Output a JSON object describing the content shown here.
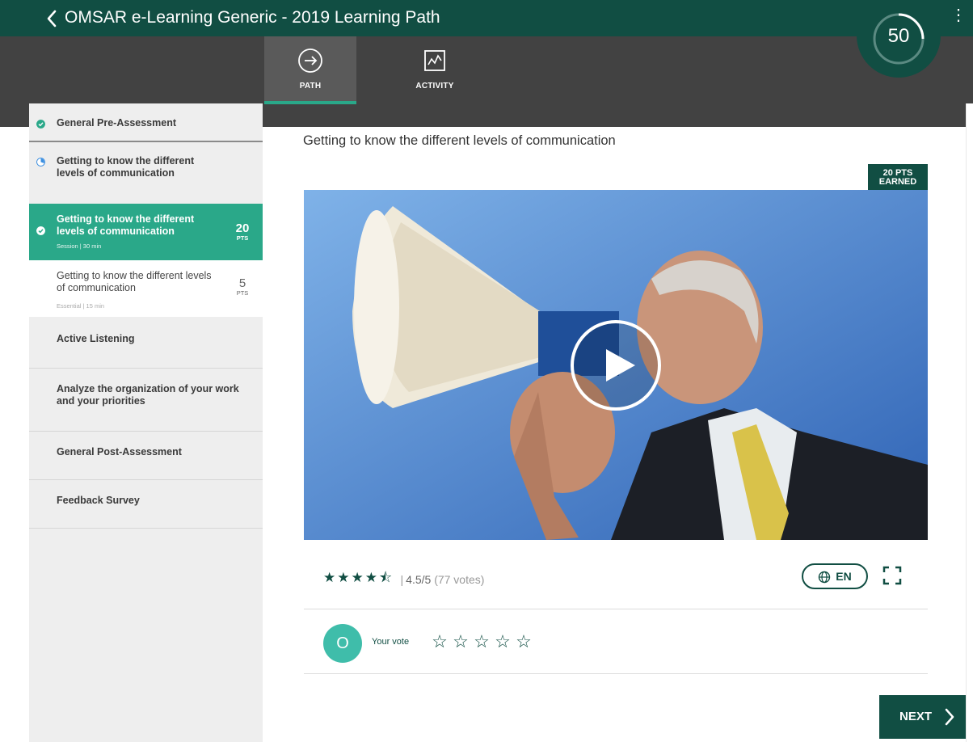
{
  "header": {
    "title": "OMSAR e-Learning Generic - 2019 Learning Path",
    "score": "50"
  },
  "nav": {
    "tabs": [
      {
        "label": "PATH",
        "icon": "arrow-circle-right-icon",
        "active": true
      },
      {
        "label": "ACTIVITY",
        "icon": "activity-chart-icon",
        "active": false
      }
    ]
  },
  "sidebar": {
    "items": [
      {
        "label": "General Pre-Assessment",
        "status": "completed"
      },
      {
        "label": "Getting to know the different levels of communication",
        "status": "in-progress"
      },
      {
        "label": "Active Listening"
      },
      {
        "label": "Analyze the organization of your work and your priorities"
      },
      {
        "label": "General Post-Assessment"
      },
      {
        "label": "Feedback Survey"
      }
    ],
    "subitems": [
      {
        "title": "Getting to know the different levels of communication",
        "meta": "Session | 30 min",
        "points": "20",
        "points_unit": "PTS",
        "selected": true
      },
      {
        "title": "Getting to know the different levels of communication",
        "meta": "Essential | 15 min",
        "points": "5",
        "points_unit": "PTS",
        "selected": false
      }
    ]
  },
  "main": {
    "title": "Getting to know the different levels of communication",
    "earned": {
      "line1": "20 PTS",
      "line2": "EARNED"
    },
    "rating": {
      "stars": 4.5,
      "value": "4.5/5",
      "votes": "(77 votes)",
      "separator": "|"
    },
    "language": "EN",
    "avatar_initial": "O",
    "your_vote_label": "Your vote",
    "next_label": "NEXT"
  },
  "colors": {
    "brand": "#114e43",
    "accent": "#2aa889",
    "avatar": "#3fbdaa",
    "navband": "#424242",
    "sidebar_bg": "#eeeeee"
  }
}
